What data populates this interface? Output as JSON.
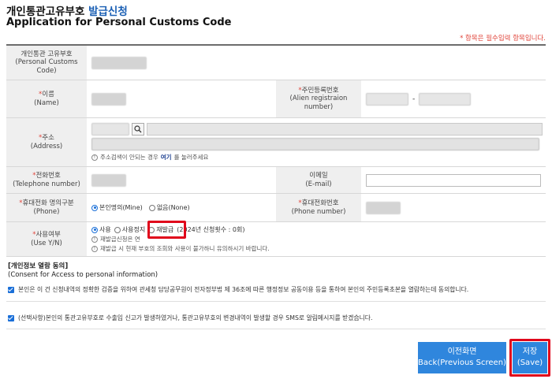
{
  "header": {
    "title_ko": "개인통관고유부호",
    "title_accent": "발급신청",
    "subtitle": "Application for Personal Customs Code",
    "required_note": "* 항목은 필수입력 항목입니다."
  },
  "form": {
    "pcc_label_ko": "개인통관 고유부호",
    "pcc_label_en": "(Personal Customs Code)",
    "name_label_ko": "이름",
    "name_label_en": "(Name)",
    "alien_label_ko": "주민등록번호",
    "alien_label_en": "(Alien registraion number)",
    "alien_separator": "-",
    "address_label_ko": "주소",
    "address_label_en": "(Address)",
    "address_hint_prefix": "주소검색이 안되는 경우",
    "address_hint_link": "여기",
    "address_hint_suffix": "를 눌러주세요",
    "tel_label_ko": "전화번호",
    "tel_label_en": "(Telephone number)",
    "email_label_ko": "이메일",
    "email_label_en": "(E-mail)",
    "phone_owner_label_ko": "휴대전화 명의구분",
    "phone_owner_label_en": "(Phone)",
    "phone_owner_options": [
      "본인명의(Mine)",
      "없음(None)"
    ],
    "phone_owner_selected": "본인명의(Mine)",
    "phone_label_ko": "휴대전화번호",
    "phone_label_en": "(Phone number)",
    "use_label_ko": "사용여부",
    "use_label_en": "(Use Y/N)",
    "use_options": [
      "사용",
      "사용정지",
      "재발급"
    ],
    "use_selected": "사용",
    "reissue_count_text": "(2024년 신청횟수 : 0회)",
    "use_hint_1": "재발급신청은 연",
    "use_hint_2": "재발급 시 현재 부호의 조회와 사용이 불가하니 유의하시기 바랍니다."
  },
  "consent": {
    "title_ko": "[개인정보 열람 동의]",
    "title_en": "(Consent for Access to personal information)",
    "check1": "본인은 이 건 신청내역의 정확한 검증을 위하여 관세청 담당공무원이 전자정부법 제 36조에 따른 행정정보 공동이용 등을 통하여 본인의 주민등록초본을 열람하는데 동의합니다.",
    "check2": "(선택사항)본인의 통관고유부호로 수출입 신고가 발생하였거나, 통관고유부호의 변경내역이 발생할 경우 SMS로 알림메시지를 받겠습니다."
  },
  "buttons": {
    "back_ko": "이전화면",
    "back_en": "Back(Previous Screen)",
    "save_ko": "저장",
    "save_en": "(Save)"
  },
  "colors": {
    "accent": "#1a5fb4",
    "button": "#2f86dd",
    "required": "#e0443a",
    "highlight": "#e0061b"
  }
}
